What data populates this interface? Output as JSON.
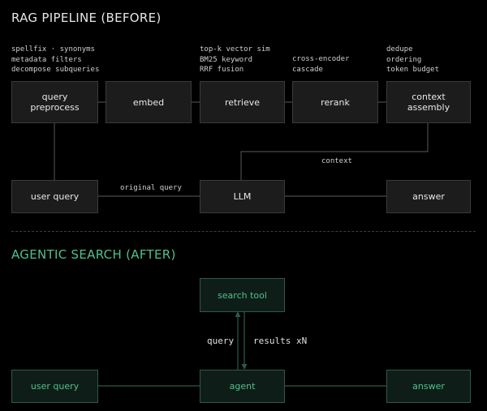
{
  "rag": {
    "title": "RAG PIPELINE (BEFORE)",
    "notes": {
      "preprocess": "spellfix · synonyms\nmetadata filters\ndecompose subqueries",
      "retrieve": "top-k vector sim\nBM25 keyword\nRRF fusion",
      "rerank": "cross-encoder\ncascade",
      "context": "dedupe\nordering\ntoken budget"
    },
    "nodes": {
      "query_preprocess": "query\npreprocess",
      "embed": "embed",
      "retrieve": "retrieve",
      "rerank": "rerank",
      "context_assembly": "context\nassembly",
      "user_query": "user query",
      "llm": "LLM",
      "answer": "answer"
    },
    "edges": {
      "context": "context",
      "original_query": "original query"
    }
  },
  "agentic": {
    "title": "AGENTIC SEARCH (AFTER)",
    "nodes": {
      "search_tool": "search tool",
      "user_query": "user query",
      "agent": "agent",
      "answer": "answer"
    },
    "edges": {
      "query": "query",
      "results": "results xN"
    }
  },
  "colors": {
    "background": "#000000",
    "rag_box_fill": "#1c1c1c",
    "rag_box_border": "#3a3a3a",
    "rag_line": "#4a4a4a",
    "agentic_accent": "#4fc08d",
    "agentic_box_fill": "#0f1d18",
    "agentic_line": "#2d5a48"
  }
}
